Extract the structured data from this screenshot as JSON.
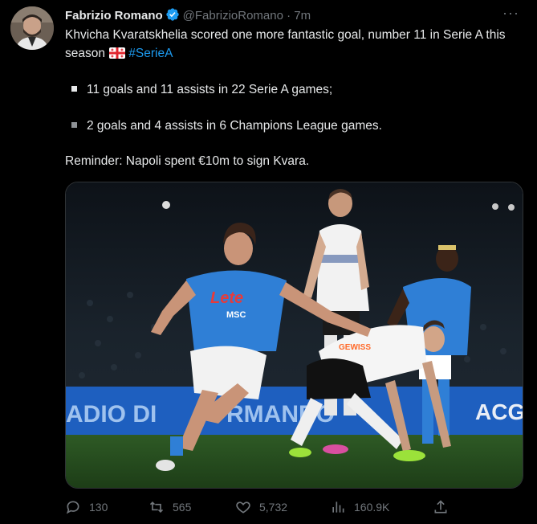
{
  "author": {
    "name": "Fabrizio Romano",
    "handle": "@FabrizioRomano",
    "separator": "·",
    "time": "7m",
    "verified": true,
    "verified_color": "#1d9bf0"
  },
  "more_icon": "···",
  "tweet": {
    "line1": "Khvicha Kvaratskhelia scored one more fantastic goal, number 11 in Serie A this season",
    "flag_icon": "georgia-flag-icon",
    "hashtag": "#SerieA",
    "bullet1": "11 goals and 11 assists in 22 Serie A games;",
    "bullet2": "2 goals and 4 assists in 6 Champions League games.",
    "reminder": "Reminder: Napoli spent €10m to sign Kvara."
  },
  "photo": {
    "banner_left": "ADIO DI",
    "banner_mid": "RMANDO",
    "banner_right": "ACG",
    "jersey_sponsor": "Lete",
    "jersey_sub": "MSC",
    "away_shirt": "GEWISS",
    "home_kit_color": "#2f7fd6",
    "away_kit_color": "#ffffff"
  },
  "actions": {
    "replies": "130",
    "retweets": "565",
    "likes": "5,732",
    "views": "160.9K"
  },
  "colors": {
    "accent": "#1d9bf0",
    "text": "#e7e9ea",
    "secondary": "#71767b"
  }
}
